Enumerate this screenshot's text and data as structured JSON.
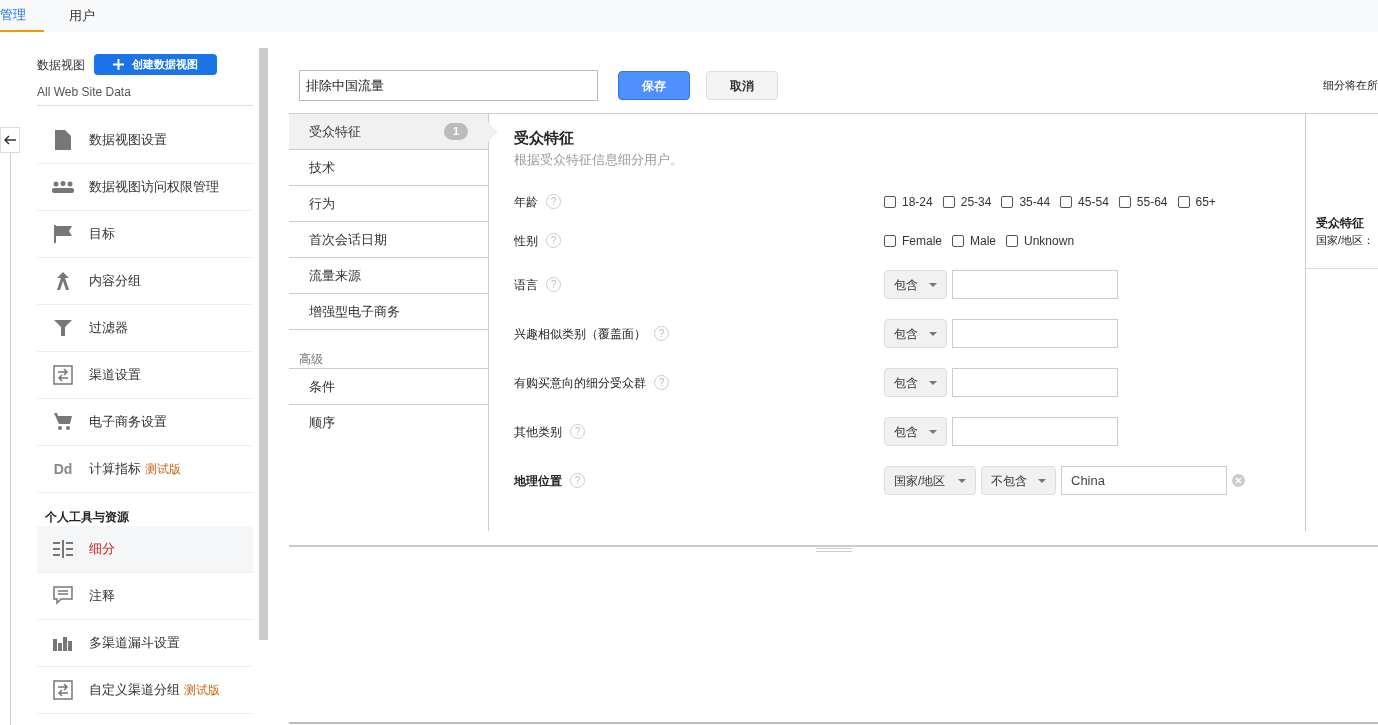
{
  "tabs": [
    {
      "label": "管理",
      "selected": true
    },
    {
      "label": "用户",
      "selected": false
    }
  ],
  "sidebar": {
    "view_label": "数据视图",
    "create_button": "创建数据视图",
    "view_name": "All Web Site Data",
    "items": [
      {
        "label": "数据视图设置",
        "selected": false
      },
      {
        "label": "数据视图访问权限管理",
        "selected": false
      },
      {
        "label": "目标",
        "selected": false
      },
      {
        "label": "内容分组",
        "selected": false
      },
      {
        "label": "过滤器",
        "selected": false
      },
      {
        "label": "渠道设置",
        "selected": false
      },
      {
        "label": "电子商务设置",
        "selected": false
      },
      {
        "label": "计算指标",
        "beta": "测试版",
        "icon_text": "Dd",
        "selected": false
      }
    ],
    "section_title": "个人工具与资源",
    "personal_items": [
      {
        "label": "细分",
        "selected": true
      },
      {
        "label": "注释",
        "selected": false
      },
      {
        "label": "多渠道漏斗设置",
        "selected": false
      },
      {
        "label": "自定义渠道分组",
        "beta": "测试版",
        "selected": false
      }
    ]
  },
  "editor": {
    "segment_name": "排除中国流量",
    "save_button": "保存",
    "cancel_button": "取消",
    "summary_note": "细分将在所",
    "nav": [
      {
        "label": "受众特征",
        "selected": true,
        "badge": "1"
      },
      {
        "label": "技术",
        "selected": false
      },
      {
        "label": "行为",
        "selected": false
      },
      {
        "label": "首次会话日期",
        "selected": false
      },
      {
        "label": "流量来源",
        "selected": false
      },
      {
        "label": "增强型电子商务",
        "selected": false
      }
    ],
    "advanced_title": "高级",
    "advanced_nav": [
      {
        "label": "条件",
        "selected": false
      },
      {
        "label": "顺序",
        "selected": false
      }
    ],
    "panel_title": "受众特征",
    "panel_subtitle": "根据受众特征信息细分用户。",
    "rows": [
      {
        "kind": "checkboxes",
        "label": "年龄",
        "help": "?",
        "bold": false,
        "options": [
          {
            "label": "18-24",
            "checked": false
          },
          {
            "label": "25-34",
            "checked": false
          },
          {
            "label": "35-44",
            "checked": false
          },
          {
            "label": "45-54",
            "checked": false
          },
          {
            "label": "55-64",
            "checked": false
          },
          {
            "label": "65+",
            "checked": false
          }
        ]
      },
      {
        "kind": "checkboxes",
        "label": "性别",
        "help": "?",
        "bold": false,
        "options": [
          {
            "label": "Female",
            "checked": false
          },
          {
            "label": "Male",
            "checked": false
          },
          {
            "label": "Unknown",
            "checked": false
          }
        ]
      },
      {
        "kind": "condition",
        "label": "语言",
        "help": "?",
        "bold": false,
        "operator": "包含"
      },
      {
        "kind": "condition",
        "label": "兴趣相似类别（覆盖面）",
        "help": "?",
        "bold": false,
        "operator": "包含"
      },
      {
        "kind": "condition",
        "label": "有购买意向的细分受众群",
        "help": "?",
        "bold": false,
        "operator": "包含"
      },
      {
        "kind": "condition",
        "label": "其他类别",
        "help": "?",
        "bold": false,
        "operator": "包含"
      },
      {
        "kind": "geo",
        "label": "地理位置",
        "help": "?",
        "bold": true,
        "dimension": "国家/地区",
        "operator": "不包含",
        "value": "China"
      }
    ],
    "summary": {
      "title": "受众特征",
      "line": "国家/地区："
    }
  }
}
